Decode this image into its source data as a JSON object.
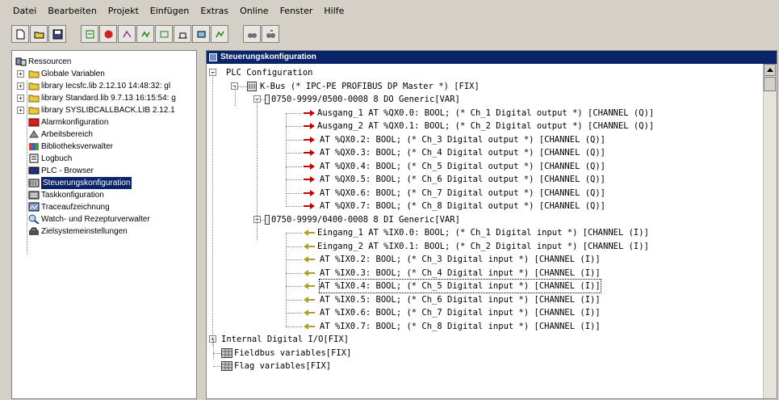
{
  "menu": [
    {
      "label": "Datei"
    },
    {
      "label": "Bearbeiten"
    },
    {
      "label": "Projekt"
    },
    {
      "label": "Einfügen"
    },
    {
      "label": "Extras"
    },
    {
      "label": "Online"
    },
    {
      "label": "Fenster"
    },
    {
      "label": "Hilfe"
    }
  ],
  "left_tree": {
    "items": [
      {
        "label": "Ressourcen",
        "icon": "resources-icon"
      },
      {
        "label": "Globale Variablen",
        "icon": "folder-icon"
      },
      {
        "label": "library Iecsfc.lib 2.12.10 14:48:32: gl",
        "icon": "folder-icon"
      },
      {
        "label": "library Standard.lib 9.7.13 16:15:54: g",
        "icon": "folder-icon"
      },
      {
        "label": "library SYSLIBCALLBACK.LIB 2.12.1",
        "icon": "folder-icon"
      },
      {
        "label": "Alarmkonfiguration",
        "icon": "alarm-icon"
      },
      {
        "label": "Arbeitsbereich",
        "icon": "workspace-icon"
      },
      {
        "label": "Bibliotheksverwalter",
        "icon": "library-manager-icon"
      },
      {
        "label": "Logbuch",
        "icon": "log-icon"
      },
      {
        "label": "PLC - Browser",
        "icon": "plc-browser-icon"
      },
      {
        "label": "Steuerungskonfiguration",
        "icon": "plc-config-icon"
      },
      {
        "label": "Taskkonfiguration",
        "icon": "task-icon"
      },
      {
        "label": "Traceaufzeichnung",
        "icon": "trace-icon"
      },
      {
        "label": "Watch- und Rezepturverwalter",
        "icon": "watch-icon"
      },
      {
        "label": "Zielsystemeinstellungen",
        "icon": "target-settings-icon"
      }
    ]
  },
  "config_window": {
    "title": "Steuerungskonfiguration",
    "rows": [
      {
        "text": "PLC Configuration"
      },
      {
        "text": "K-Bus (* IPC-PE PROFIBUS DP Master *) [FIX]"
      },
      {
        "text": "0750-9999/0500-0008 8 DO Generic[VAR]"
      },
      {
        "text": "Ausgang_1 AT %QX0.0: BOOL; (* Ch_1 Digital output *) [CHANNEL (Q)]"
      },
      {
        "text": "Ausgang_2 AT %QX0.1: BOOL; (* Ch_2 Digital output *) [CHANNEL (Q)]"
      },
      {
        "text": "AT %QX0.2: BOOL; (* Ch_3 Digital output *) [CHANNEL (Q)]"
      },
      {
        "text": "AT %QX0.3: BOOL; (* Ch_4 Digital output *) [CHANNEL (Q)]"
      },
      {
        "text": "AT %QX0.4: BOOL; (* Ch_5 Digital output *) [CHANNEL (Q)]"
      },
      {
        "text": "AT %QX0.5: BOOL; (* Ch_6 Digital output *) [CHANNEL (Q)]"
      },
      {
        "text": "AT %QX0.6: BOOL; (* Ch_7 Digital output *) [CHANNEL (Q)]"
      },
      {
        "text": "AT %QX0.7: BOOL; (* Ch_8 Digital output *) [CHANNEL (Q)]"
      },
      {
        "text": "0750-9999/0400-0008 8 DI Generic[VAR]"
      },
      {
        "text": "Eingang_1 AT %IX0.0: BOOL; (* Ch_1 Digital input *) [CHANNEL (I)]"
      },
      {
        "text": "Eingang_2 AT %IX0.1: BOOL; (* Ch_2 Digital input *) [CHANNEL (I)]"
      },
      {
        "text": "AT %IX0.2: BOOL; (* Ch_3 Digital input *) [CHANNEL (I)]"
      },
      {
        "text": "AT %IX0.3: BOOL; (* Ch_4 Digital input *) [CHANNEL (I)]"
      },
      {
        "text": "AT %IX0.4: BOOL; (* Ch_5 Digital input *) [CHANNEL (I)]"
      },
      {
        "text": "AT %IX0.5: BOOL; (* Ch_6 Digital input *) [CHANNEL (I)]"
      },
      {
        "text": "AT %IX0.6: BOOL; (* Ch_7 Digital input *) [CHANNEL (I)]"
      },
      {
        "text": "AT %IX0.7: BOOL; (* Ch_8 Digital input *) [CHANNEL (I)]"
      },
      {
        "text": "Internal Digital I/O[FIX]"
      },
      {
        "text": "Fieldbus variables[FIX]"
      },
      {
        "text": "Flag variables[FIX]"
      }
    ]
  },
  "colors": {
    "selection": "#0a246a",
    "title_bar": "#0a246a",
    "output_arrow": "#c00000",
    "input_arrow": "#b0a020",
    "folder": "#e8c840"
  }
}
